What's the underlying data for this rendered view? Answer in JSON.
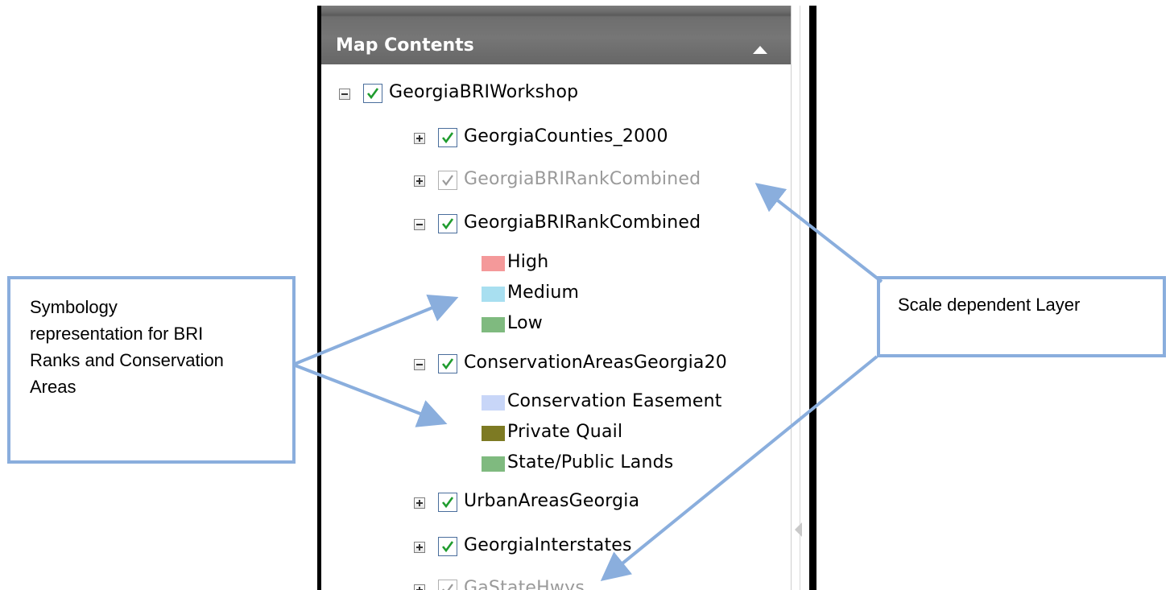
{
  "panel": {
    "title": "Map Contents"
  },
  "tree": {
    "root_label": "GeorgiaBRIWorkshop",
    "counties_label": "GeorgiaCounties_2000",
    "bri_scale_label": "GeorgiaBRIRankCombined",
    "bri_label": "GeorgiaBRIRankCombined",
    "bri_legend": [
      {
        "label": "High",
        "color": "#f4999a"
      },
      {
        "label": "Medium",
        "color": "#a8dff0"
      },
      {
        "label": "Low",
        "color": "#7fba7f"
      }
    ],
    "conservation_label": "ConservationAreasGeorgia20",
    "conservation_legend": [
      {
        "label": "Conservation Easement",
        "color": "#c8d6f8"
      },
      {
        "label": "Private Quail",
        "color": "#7d7a23"
      },
      {
        "label": "State/Public Lands",
        "color": "#7fba7f"
      }
    ],
    "urban_label": "UrbanAreasGeorgia",
    "interstates_label": "GeorgiaInterstates",
    "hwys_label": "GaStateHwys"
  },
  "callouts": {
    "symbology_text": "Symbology representation for BRI Ranks and Conservation Areas",
    "symbology_lines": [
      "Symbology",
      "representation for BRI",
      "Ranks and Conservation",
      "Areas"
    ],
    "scale_text": "Scale dependent Layer"
  },
  "colors": {
    "callout_border": "#8aaedd",
    "arrow": "#8aaedd",
    "check_green": "#1f9c2e"
  }
}
